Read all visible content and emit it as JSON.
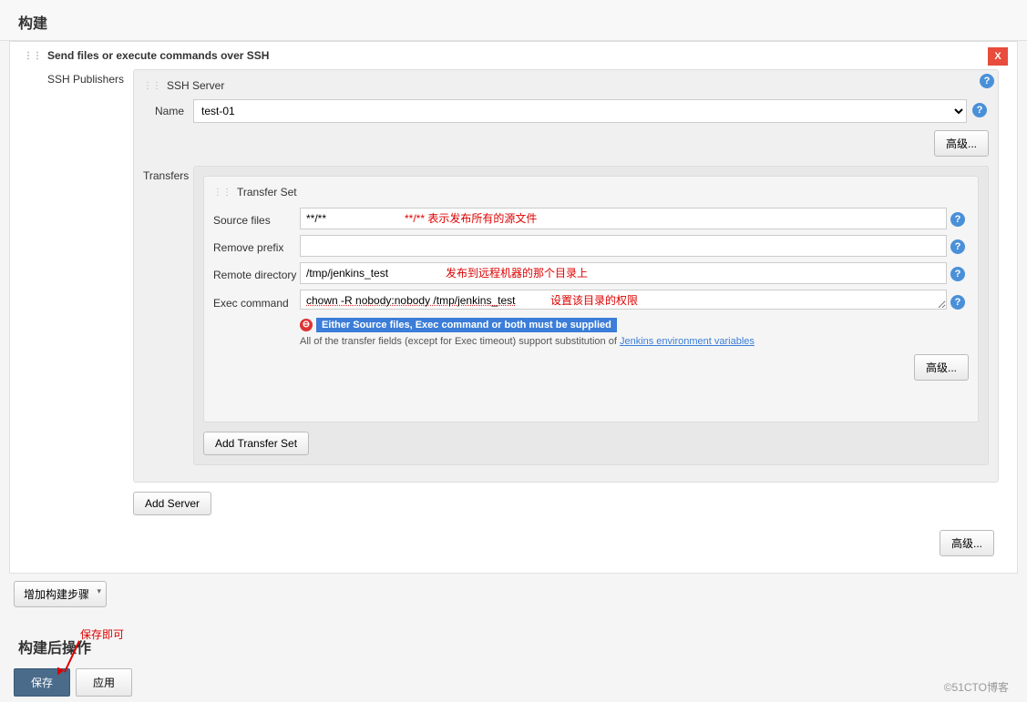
{
  "section": {
    "build_title": "构建",
    "post_build_title": "构建后操作"
  },
  "step": {
    "title": "Send files or execute commands over SSH",
    "close_label": "X",
    "ssh_publishers_label": "SSH Publishers",
    "ssh_server_header": "SSH Server",
    "name_label": "Name",
    "name_value": "test-01",
    "advanced_label": "高级...",
    "transfers_label": "Transfers",
    "transfer_set_header": "Transfer Set",
    "source_files_label": "Source files",
    "source_files_value": "**/**",
    "source_files_annotation": "**/** 表示发布所有的源文件",
    "remove_prefix_label": "Remove prefix",
    "remove_prefix_value": "",
    "remote_directory_label": "Remote directory",
    "remote_directory_value": "/tmp/jenkins_test",
    "remote_directory_annotation": "发布到远程机器的那个目录上",
    "exec_command_label": "Exec command",
    "exec_command_value": "chown -R nobody:nobody /tmp/jenkins_test",
    "exec_command_annotation": "设置该目录的权限",
    "error_message": "Either Source files, Exec command or both must be supplied",
    "hint_prefix": "All of the transfer fields (except for Exec timeout) support substitution of ",
    "hint_link": "Jenkins environment variables",
    "add_transfer_label": "Add Transfer Set",
    "add_server_label": "Add Server"
  },
  "bottom": {
    "add_build_step_label": "增加构建步骤",
    "save_annotation": "保存即可",
    "save_label": "保存",
    "apply_label": "应用"
  },
  "watermark": "©51CTO博客"
}
